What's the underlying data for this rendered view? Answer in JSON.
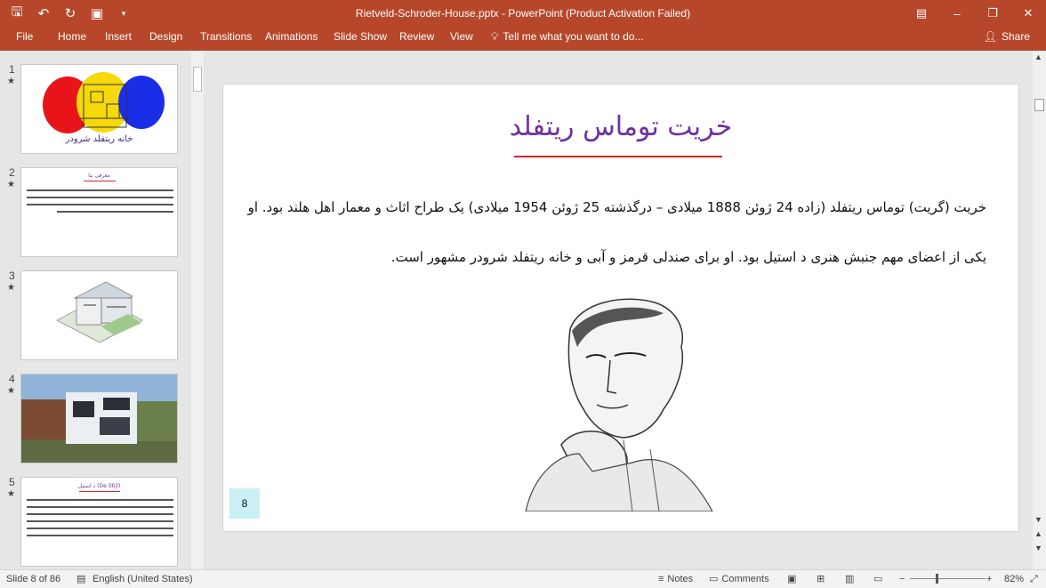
{
  "titlebar": {
    "title": "Rietveld-Schroder-House.pptx - PowerPoint (Product Activation Failed)",
    "icons": [
      "save-icon",
      "undo-icon",
      "redo-icon",
      "present-icon",
      "customize-icon"
    ]
  },
  "ribbon": {
    "tabs": [
      "File",
      "Home",
      "Insert",
      "Design",
      "Transitions",
      "Animations",
      "Slide Show",
      "Review",
      "View"
    ],
    "tell_me": "Tell me what you want to do...",
    "share": "Share"
  },
  "thumbnails": [
    {
      "number": "1",
      "star": "★",
      "caption": "خانه ريتفلد شرودر"
    },
    {
      "number": "2",
      "star": "★",
      "caption": "معرفی بنا"
    },
    {
      "number": "3",
      "star": "★"
    },
    {
      "number": "4",
      "star": "★"
    },
    {
      "number": "5",
      "star": "★",
      "caption": "د استيل (De Stijl)"
    }
  ],
  "slide": {
    "title": "خريت توماس ريتفلد",
    "body": "خريت (گريت) توماس ريتفلد (زاده 24 ژوئن 1888 ميلادی – درگذشته 25 ژوئن 1954 ميلادی) يک طراح اثاث و معمار اهل هلند بود. او يکی از اعضای مهم جنبش هنری د استيل بود. او برای صندلی قرمز و آبی و خانه ريتفلد شرودر مشهور است.",
    "number": "8"
  },
  "statusbar": {
    "slide_info": "Slide 8 of 86",
    "language": "English (United States)",
    "notes": "Notes",
    "comments": "Comments",
    "zoom_minus": "−",
    "zoom_plus": "+",
    "zoom": "82%"
  },
  "colors": {
    "accent": "#b7472a",
    "title": "#7030a0",
    "underline": "#d9242f"
  }
}
